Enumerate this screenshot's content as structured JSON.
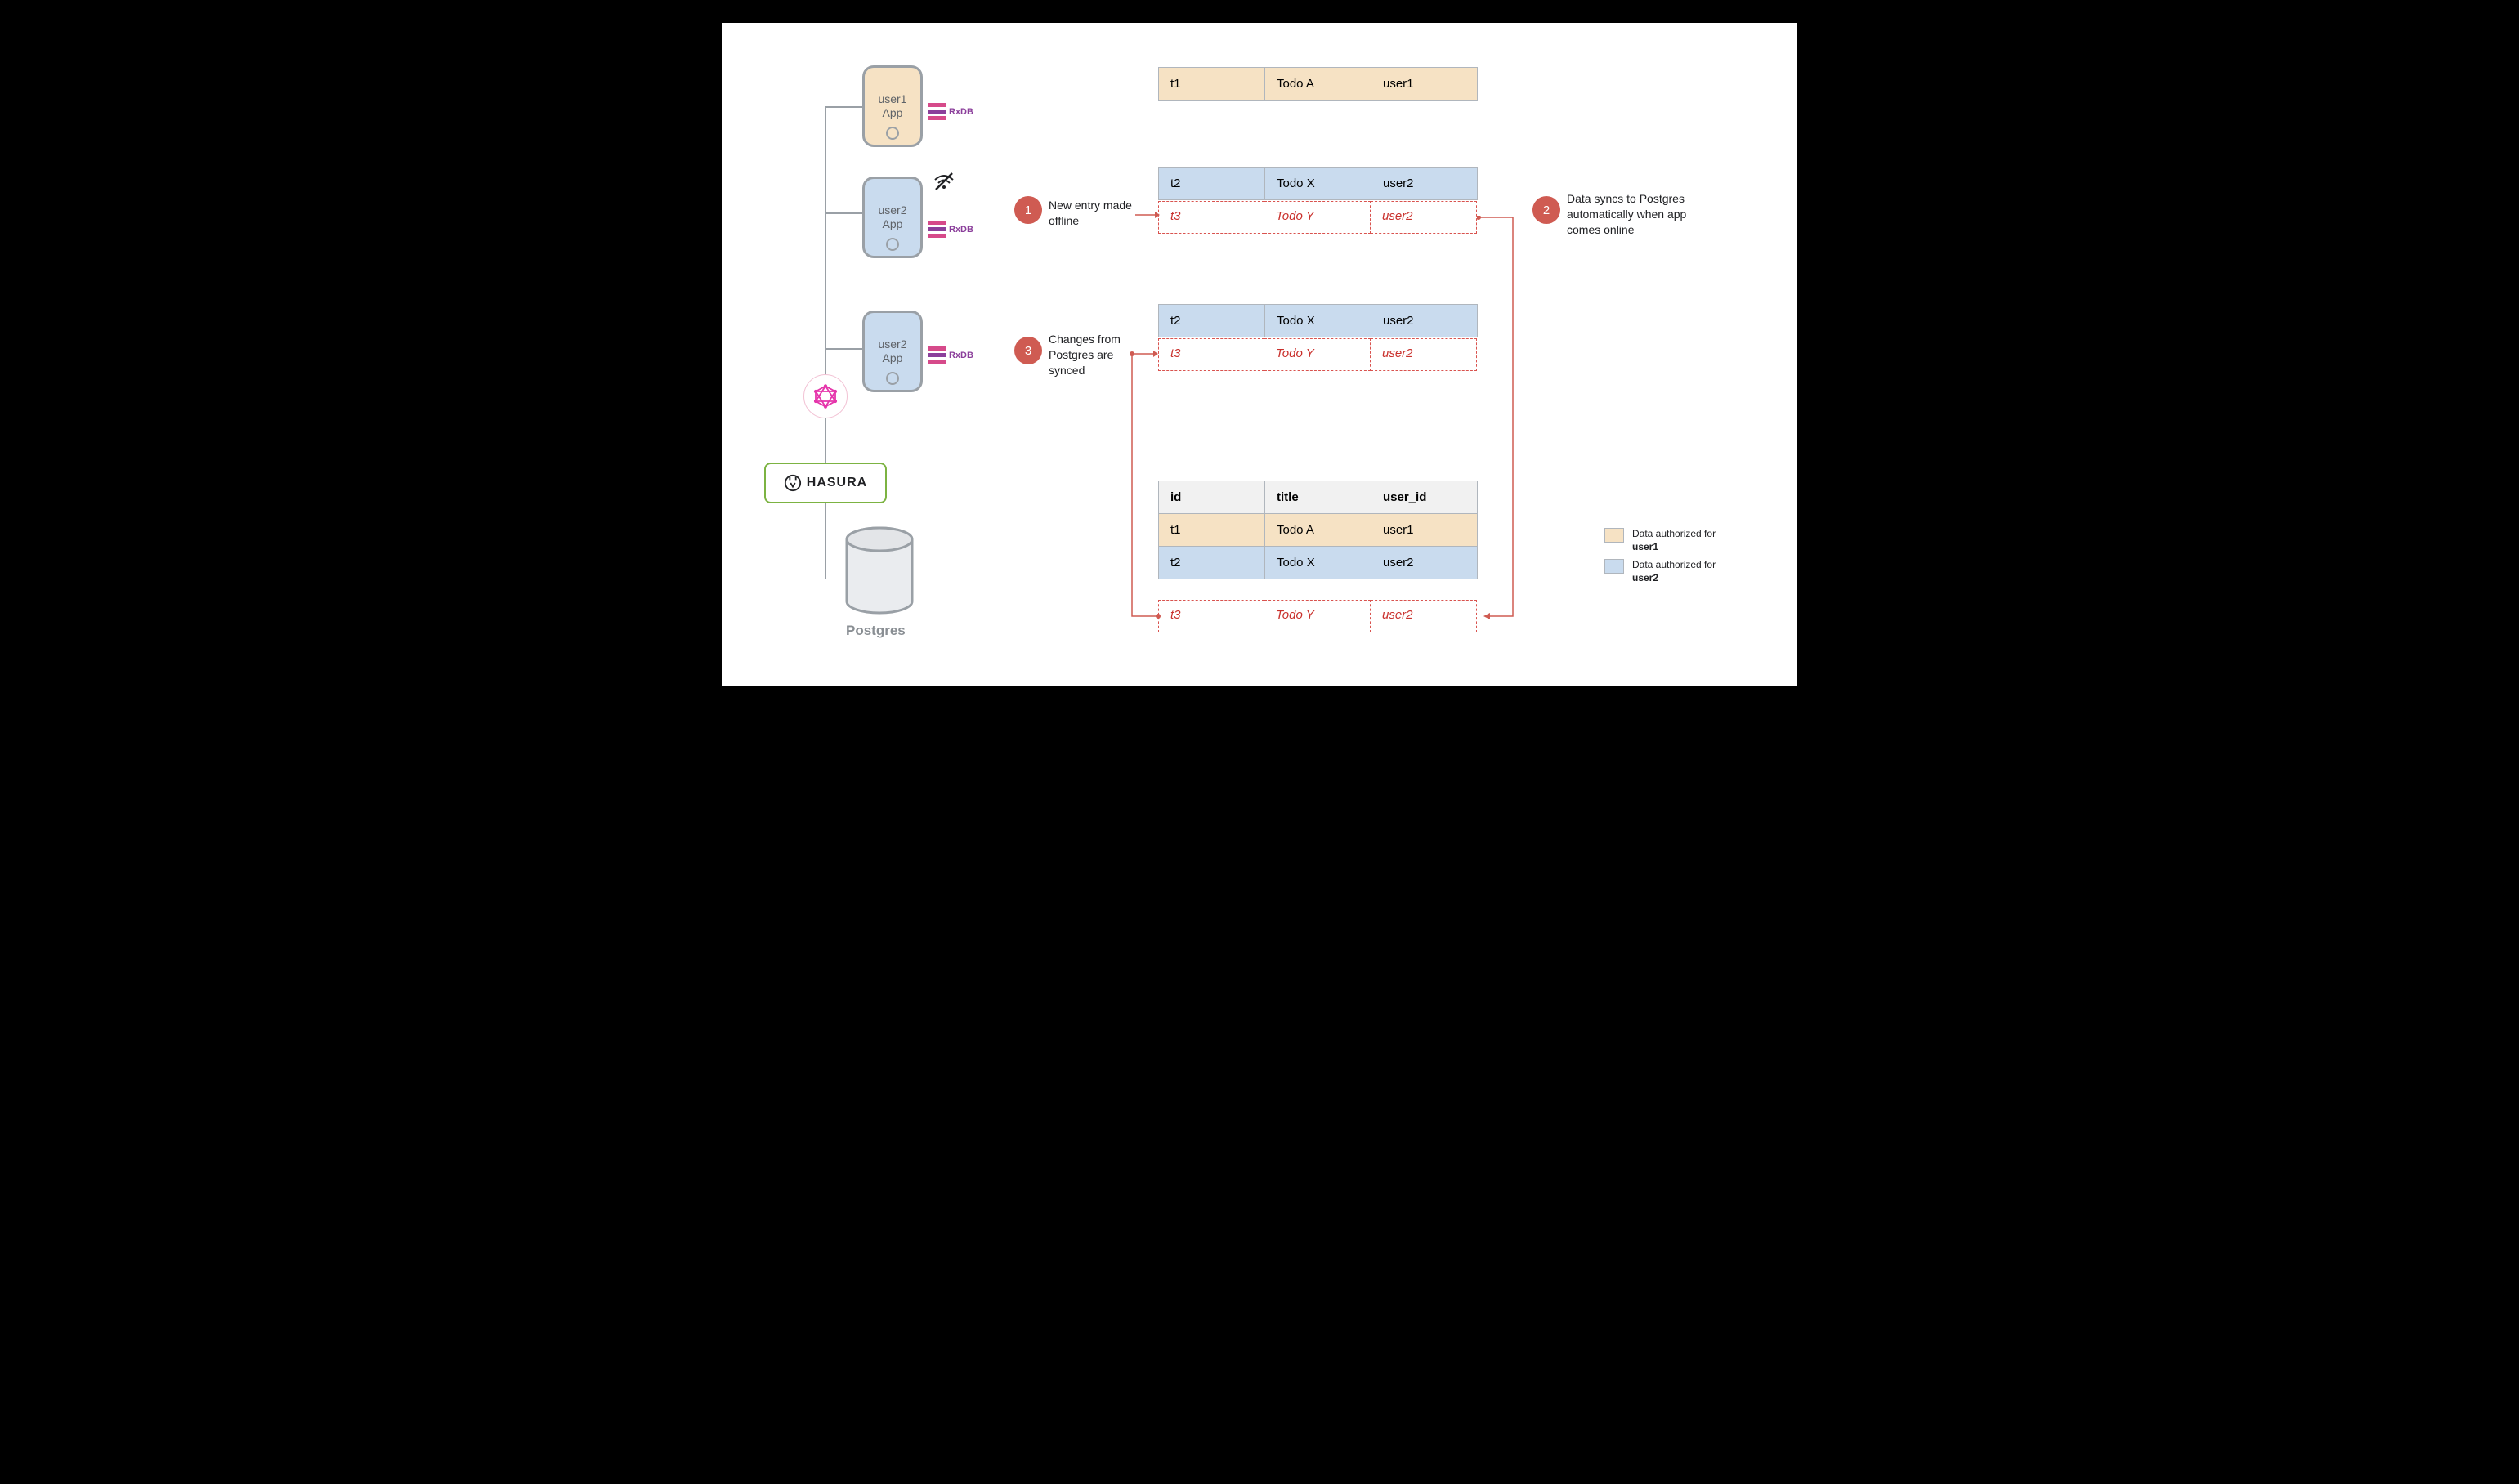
{
  "devices": {
    "user1": "user1\nApp",
    "user2a": "user2\nApp",
    "user2b": "user2\nApp"
  },
  "rxdb_label": "RxDB",
  "hasura_label": "HASURA",
  "postgres_label": "Postgres",
  "row_user1": {
    "id": "t1",
    "title": "Todo A",
    "user": "user1"
  },
  "row_user2": {
    "id": "t2",
    "title": "Todo X",
    "user": "user2"
  },
  "row_new": {
    "id": "t3",
    "title": "Todo Y",
    "user": "user2"
  },
  "db_table": {
    "headers": {
      "c1": "id",
      "c2": "title",
      "c3": "user_id"
    }
  },
  "annotations": {
    "a1": {
      "num": "1",
      "text": "New entry made offline"
    },
    "a2": {
      "num": "2",
      "text": "Data syncs to Postgres automatically when app comes online"
    },
    "a3": {
      "num": "3",
      "text": "Changes from Postgres are synced"
    }
  },
  "legend": {
    "u1_pre": "Data authorized for",
    "u1_bold": "user1",
    "u2_pre": "Data authorized for",
    "u2_bold": "user2"
  }
}
